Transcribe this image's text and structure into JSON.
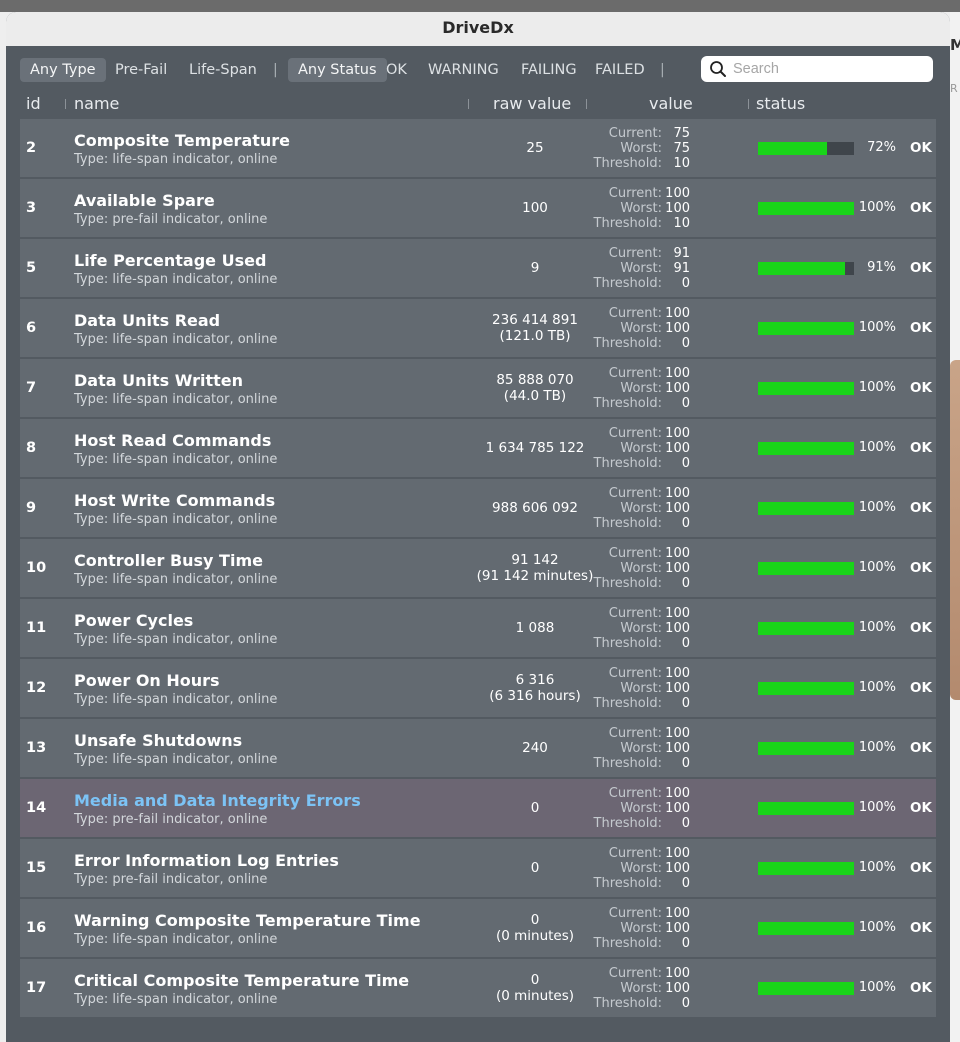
{
  "window": {
    "title": "DriveDx"
  },
  "desktop": {
    "glyph1": "M",
    "glyph2": "R"
  },
  "filters": {
    "type_buttons": [
      "Any Type",
      "Pre-Fail",
      "Life-Span"
    ],
    "status_buttons": [
      "Any Status",
      "OK",
      "WARNING",
      "FAILING",
      "FAILED"
    ],
    "selected_type": "Any Type",
    "selected_status": "Any Status",
    "separator": "|"
  },
  "search": {
    "placeholder": "Search",
    "value": ""
  },
  "columns": {
    "id": "id",
    "name": "name",
    "raw": "raw value",
    "value": "value",
    "status": "status"
  },
  "labels": {
    "current": "Current:",
    "worst": "Worst:",
    "threshold": "Threshold:"
  },
  "colors": {
    "bar_fill": "#19d419",
    "highlight_title": "#7cc3f5"
  },
  "rows": [
    {
      "id": "2",
      "title": "Composite Temperature",
      "subtitle": "Type: life-span indicator, online",
      "raw": [
        "25"
      ],
      "current": "75",
      "worst": "75",
      "threshold": "10",
      "progress": 72,
      "pct": "72%",
      "status": "OK"
    },
    {
      "id": "3",
      "title": "Available Spare",
      "subtitle": "Type: pre-fail indicator, online",
      "raw": [
        "100"
      ],
      "current": "100",
      "worst": "100",
      "threshold": "10",
      "progress": 100,
      "pct": "100%",
      "status": "OK"
    },
    {
      "id": "5",
      "title": "Life Percentage Used",
      "subtitle": "Type: life-span indicator, online",
      "raw": [
        "9"
      ],
      "current": "91",
      "worst": "91",
      "threshold": "0",
      "progress": 91,
      "pct": "91%",
      "status": "OK"
    },
    {
      "id": "6",
      "title": "Data Units Read",
      "subtitle": "Type: life-span indicator, online",
      "raw": [
        "236 414 891",
        "(121.0 TB)"
      ],
      "current": "100",
      "worst": "100",
      "threshold": "0",
      "progress": 100,
      "pct": "100%",
      "status": "OK"
    },
    {
      "id": "7",
      "title": "Data Units Written",
      "subtitle": "Type: life-span indicator, online",
      "raw": [
        "85 888 070",
        "(44.0 TB)"
      ],
      "current": "100",
      "worst": "100",
      "threshold": "0",
      "progress": 100,
      "pct": "100%",
      "status": "OK"
    },
    {
      "id": "8",
      "title": "Host Read Commands",
      "subtitle": "Type: life-span indicator, online",
      "raw": [
        "1 634 785 122"
      ],
      "current": "100",
      "worst": "100",
      "threshold": "0",
      "progress": 100,
      "pct": "100%",
      "status": "OK"
    },
    {
      "id": "9",
      "title": "Host Write Commands",
      "subtitle": "Type: life-span indicator, online",
      "raw": [
        "988 606 092"
      ],
      "current": "100",
      "worst": "100",
      "threshold": "0",
      "progress": 100,
      "pct": "100%",
      "status": "OK"
    },
    {
      "id": "10",
      "title": "Controller Busy Time",
      "subtitle": "Type: life-span indicator, online",
      "raw": [
        "91 142",
        "(91 142 minutes)"
      ],
      "current": "100",
      "worst": "100",
      "threshold": "0",
      "progress": 100,
      "pct": "100%",
      "status": "OK"
    },
    {
      "id": "11",
      "title": "Power Cycles",
      "subtitle": "Type: life-span indicator, online",
      "raw": [
        "1 088"
      ],
      "current": "100",
      "worst": "100",
      "threshold": "0",
      "progress": 100,
      "pct": "100%",
      "status": "OK"
    },
    {
      "id": "12",
      "title": "Power On Hours",
      "subtitle": "Type: life-span indicator, online",
      "raw": [
        "6 316",
        "(6 316 hours)"
      ],
      "current": "100",
      "worst": "100",
      "threshold": "0",
      "progress": 100,
      "pct": "100%",
      "status": "OK"
    },
    {
      "id": "13",
      "title": "Unsafe Shutdowns",
      "subtitle": "Type: life-span indicator, online",
      "raw": [
        "240"
      ],
      "current": "100",
      "worst": "100",
      "threshold": "0",
      "progress": 100,
      "pct": "100%",
      "status": "OK"
    },
    {
      "id": "14",
      "title": "Media and Data Integrity Errors",
      "subtitle": "Type: pre-fail indicator, online",
      "raw": [
        "0"
      ],
      "current": "100",
      "worst": "100",
      "threshold": "0",
      "progress": 100,
      "pct": "100%",
      "status": "OK",
      "highlighted": true
    },
    {
      "id": "15",
      "title": "Error Information Log Entries",
      "subtitle": "Type: pre-fail indicator, online",
      "raw": [
        "0"
      ],
      "current": "100",
      "worst": "100",
      "threshold": "0",
      "progress": 100,
      "pct": "100%",
      "status": "OK"
    },
    {
      "id": "16",
      "title": "Warning Composite Temperature Time",
      "subtitle": "Type: life-span indicator, online",
      "raw": [
        "0",
        "(0 minutes)"
      ],
      "current": "100",
      "worst": "100",
      "threshold": "0",
      "progress": 100,
      "pct": "100%",
      "status": "OK"
    },
    {
      "id": "17",
      "title": "Critical Composite Temperature Time",
      "subtitle": "Type: life-span indicator, online",
      "raw": [
        "0",
        "(0 minutes)"
      ],
      "current": "100",
      "worst": "100",
      "threshold": "0",
      "progress": 100,
      "pct": "100%",
      "status": "OK"
    }
  ]
}
